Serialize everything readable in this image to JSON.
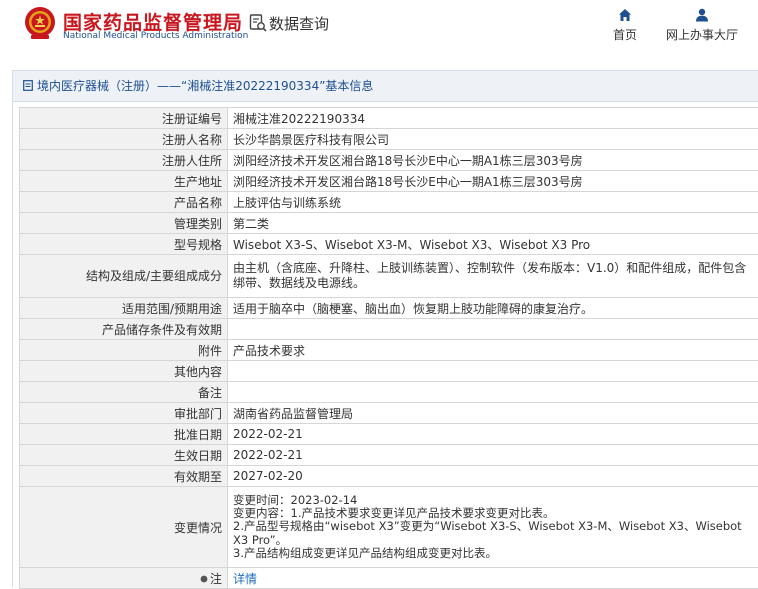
{
  "header": {
    "site_title": "国家药品监督管理局",
    "site_subtitle": "National Medical Products Administration",
    "data_query": "数据查询",
    "nav": {
      "home": "首页",
      "hall": "网上办事大厅"
    }
  },
  "breadcrumb": "境内医疗器械（注册）——“湘械注准20222190334”基本信息",
  "rows": [
    {
      "label": "注册证编号",
      "value": "湘械注准20222190334"
    },
    {
      "label": "注册人名称",
      "value": "长沙华鹊景医疗科技有限公司"
    },
    {
      "label": "注册人住所",
      "value": "浏阳经济技术开发区湘台路18号长沙E中心一期A1栋三层303号房"
    },
    {
      "label": "生产地址",
      "value": "浏阳经济技术开发区湘台路18号长沙E中心一期A1栋三层303号房"
    },
    {
      "label": "产品名称",
      "value": "上肢评估与训练系统"
    },
    {
      "label": "管理类别",
      "value": "第二类"
    },
    {
      "label": "型号规格",
      "value": "Wisebot X3-S、Wisebot X3-M、Wisebot X3、Wisebot X3 Pro"
    },
    {
      "label": "结构及组成/主要组成成分",
      "value": "由主机（含底座、升降柱、上肢训练装置）、控制软件（发布版本：V1.0）和配件组成，配件包含绑带、数据线及电源线。"
    },
    {
      "label": "适用范围/预期用途",
      "value": "适用于脑卒中（脑梗塞、脑出血）恢复期上肢功能障碍的康复治疗。"
    },
    {
      "label": "产品储存条件及有效期",
      "value": ""
    },
    {
      "label": "附件",
      "value": "产品技术要求"
    },
    {
      "label": "其他内容",
      "value": ""
    },
    {
      "label": "备注",
      "value": ""
    },
    {
      "label": "审批部门",
      "value": "湖南省药品监督管理局"
    },
    {
      "label": "批准日期",
      "value": "2022-02-21"
    },
    {
      "label": "生效日期",
      "value": "2022-02-21"
    },
    {
      "label": "有效期至",
      "value": "2027-02-20"
    }
  ],
  "change": {
    "label": "变更情况",
    "lines": [
      "变更时间：2023-02-14",
      "变更内容：1.产品技术要求变更详见产品技术要求变更对比表。",
      "2.产品型号规格由“wisebot X3”变更为“Wisebot X3-S、Wisebot X3-M、Wisebot X3、Wisebot X3 Pro”。",
      "3.产品结构组成变更详见产品结构组成变更对比表。"
    ]
  },
  "note": {
    "label": "注",
    "link_text": "详情",
    "icon": "bullet-icon"
  },
  "colors": {
    "brand_red": "#c8171e",
    "brand_blue": "#1d4f91",
    "label_bg": "#f1f1f1",
    "link": "#1d6fbf"
  }
}
